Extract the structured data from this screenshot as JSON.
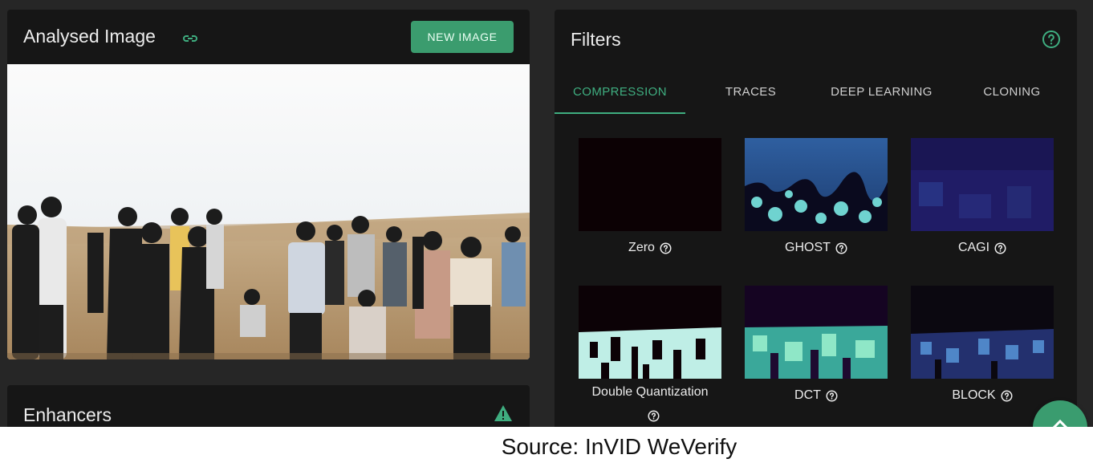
{
  "analysed": {
    "title": "Analysed Image",
    "link_icon": "link-icon",
    "new_image_label": "NEW IMAGE"
  },
  "enhancers": {
    "title": "Enhancers",
    "status_icon": "warning-icon"
  },
  "filters": {
    "title": "Filters",
    "help_icon": "help-circle-icon",
    "tabs": [
      {
        "label": "COMPRESSION",
        "active": true
      },
      {
        "label": "TRACES",
        "active": false
      },
      {
        "label": "DEEP LEARNING",
        "active": false
      },
      {
        "label": "CLONING",
        "active": false
      }
    ],
    "items": [
      {
        "label": "Zero"
      },
      {
        "label": "GHOST"
      },
      {
        "label": "CAGI"
      },
      {
        "label": "Double Quantization"
      },
      {
        "label": "DCT"
      },
      {
        "label": "BLOCK"
      }
    ]
  },
  "fab": {
    "icon": "chevron-up-icon"
  },
  "caption": "Source: InVID WeVerify",
  "colors": {
    "accent": "#3b9c6e",
    "card": "#161616",
    "background": "#262626"
  }
}
